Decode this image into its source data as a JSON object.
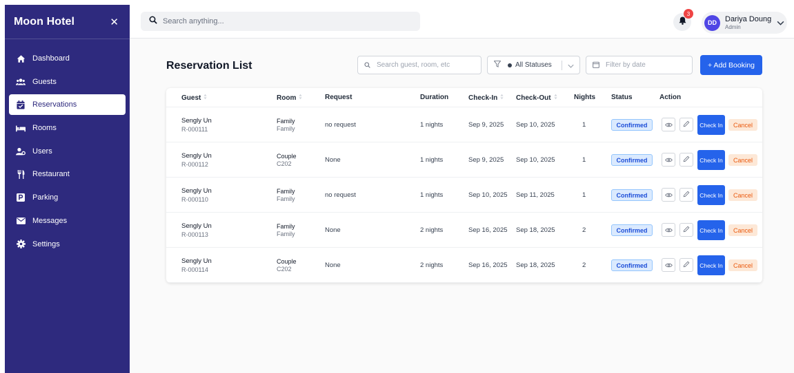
{
  "sidebar": {
    "title": "Moon Hotel",
    "items": [
      {
        "label": "Dashboard",
        "icon": "home-icon",
        "active": false
      },
      {
        "label": "Guests",
        "icon": "users-group-icon",
        "active": false
      },
      {
        "label": "Reservations",
        "icon": "calendar-check-icon",
        "active": true
      },
      {
        "label": "Rooms",
        "icon": "bed-icon",
        "active": false
      },
      {
        "label": "Users",
        "icon": "user-cog-icon",
        "active": false
      },
      {
        "label": "Restaurant",
        "icon": "utensils-icon",
        "active": false
      },
      {
        "label": "Parking",
        "icon": "parking-icon",
        "active": false
      },
      {
        "label": "Messages",
        "icon": "envelope-icon",
        "active": false
      },
      {
        "label": "Settings",
        "icon": "gear-icon",
        "active": false
      }
    ]
  },
  "header": {
    "search_placeholder": "Search anything...",
    "notification_count": "3",
    "user": {
      "initials": "DD",
      "name": "Dariya Doung",
      "role": "Admin"
    }
  },
  "main": {
    "title": "Reservation List",
    "search_placeholder": "Search guest, room, etc",
    "status_filter": "All Statuses",
    "date_placeholder": "Filter by date",
    "add_label": "+ Add Booking"
  },
  "table": {
    "columns": {
      "guest": "Guest",
      "room": "Room",
      "request": "Request",
      "duration": "Duration",
      "checkin": "Check-In",
      "checkout": "Check-Out",
      "nights": "Nights",
      "status": "Status",
      "action": "Action"
    },
    "checkin_label": "Check In",
    "cancel_label": "Cancel",
    "rows": [
      {
        "guest": "Sengly Un",
        "id": "R-000111",
        "room_type": "Family",
        "room": "Family",
        "request": "no request",
        "duration": "1 nights",
        "checkin": "Sep 9, 2025",
        "checkout": "Sep 10, 2025",
        "nights": "1",
        "status": "Confirmed"
      },
      {
        "guest": "Sengly Un",
        "id": "R-000112",
        "room_type": "Couple",
        "room": "C202",
        "request": "None",
        "duration": "1 nights",
        "checkin": "Sep 9, 2025",
        "checkout": "Sep 10, 2025",
        "nights": "1",
        "status": "Confirmed"
      },
      {
        "guest": "Sengly Un",
        "id": "R-000110",
        "room_type": "Family",
        "room": "Family",
        "request": "no request",
        "duration": "1 nights",
        "checkin": "Sep 10, 2025",
        "checkout": "Sep 11, 2025",
        "nights": "1",
        "status": "Confirmed"
      },
      {
        "guest": "Sengly Un",
        "id": "R-000113",
        "room_type": "Family",
        "room": "Family",
        "request": "None",
        "duration": "2 nights",
        "checkin": "Sep 16, 2025",
        "checkout": "Sep 18, 2025",
        "nights": "2",
        "status": "Confirmed"
      },
      {
        "guest": "Sengly Un",
        "id": "R-000114",
        "room_type": "Couple",
        "room": "C202",
        "request": "None",
        "duration": "2 nights",
        "checkin": "Sep 16, 2025",
        "checkout": "Sep 18, 2025",
        "nights": "2",
        "status": "Confirmed"
      }
    ]
  },
  "colors": {
    "sidebar_bg": "#2e2a7e",
    "primary": "#2563eb",
    "badge_bg": "#dbeafe",
    "cancel_bg": "#fde8d7",
    "cancel_text": "#ea580c",
    "notification": "#ef4444"
  }
}
